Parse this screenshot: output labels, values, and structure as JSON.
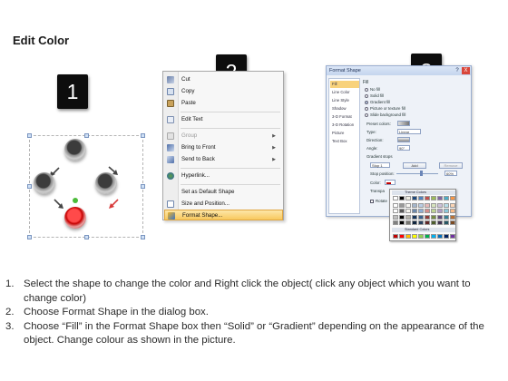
{
  "title": "Edit Color",
  "steps": [
    "1",
    "2",
    "3"
  ],
  "context_menu": {
    "items": [
      {
        "label": "Cut",
        "icon": "scissors-icon",
        "disabled": false
      },
      {
        "label": "Copy",
        "icon": "copy-icon",
        "disabled": false
      },
      {
        "label": "Paste",
        "icon": "paste-icon",
        "disabled": false
      },
      {
        "label": "Edit Text",
        "icon": "edit-text-icon",
        "disabled": false
      },
      {
        "label": "Group",
        "icon": "group-icon",
        "disabled": true
      },
      {
        "label": "Bring to Front",
        "icon": "bring-front-icon",
        "disabled": false
      },
      {
        "label": "Send to Back",
        "icon": "send-back-icon",
        "disabled": false
      },
      {
        "label": "Hyperlink...",
        "icon": "hyperlink-icon",
        "disabled": false
      },
      {
        "label": "Set as Default Shape",
        "icon": "",
        "disabled": false
      },
      {
        "label": "Size and Position...",
        "icon": "size-icon",
        "disabled": false
      },
      {
        "label": "Format Shape...",
        "icon": "format-shape-icon",
        "disabled": false
      }
    ]
  },
  "dialog": {
    "title": "Format Shape",
    "help": "?",
    "close": "X",
    "nav": [
      "Fill",
      "Line Color",
      "Line Style",
      "Shadow",
      "3-D Format",
      "3-D Rotation",
      "Picture",
      "Text Box"
    ],
    "fill_heading": "Fill",
    "fill_options": [
      "No fill",
      "Solid fill",
      "Gradient fill",
      "Picture or texture fill",
      "Slide background fill"
    ],
    "preset_label": "Preset colors:",
    "type_label": "Type:",
    "type_value": "Linear",
    "direction_label": "Direction:",
    "angle_label": "Angle:",
    "angle_value": "90°",
    "stops_label": "Gradient stops",
    "stop_value": "Stop 1",
    "add_label": "Add",
    "remove_label": "Remove",
    "stop_position_label": "Stop position:",
    "stop_position_value": "60%",
    "color_label": "Color:",
    "transparency_label": "Transpa",
    "rotate_label": "Rotate"
  },
  "color_picker": {
    "theme_header": "Theme Colors",
    "standard_header": "Standard Colors",
    "theme_colors": [
      "#ffffff",
      "#000000",
      "#eeece1",
      "#1f497d",
      "#4f81bd",
      "#c0504d",
      "#9bbb59",
      "#8064a2",
      "#4bacc6",
      "#f79646"
    ],
    "standard_colors": [
      "#c00000",
      "#ff0000",
      "#ffc000",
      "#ffff00",
      "#92d050",
      "#00b050",
      "#00b0f0",
      "#0070c0",
      "#002060",
      "#7030a0"
    ]
  },
  "instructions": [
    {
      "num": "1.",
      "text": "Select the shape to change the color and Right click the object( click any object which you want to change color)"
    },
    {
      "num": "2.",
      "text": "Choose Format Shape in the dialog box."
    },
    {
      "num": "3.",
      "text": "Choose “Fill” in the Format Shape box then “Solid” or “Gradient” depending on the appearance of the object. Change colour as shown in the picture."
    }
  ]
}
